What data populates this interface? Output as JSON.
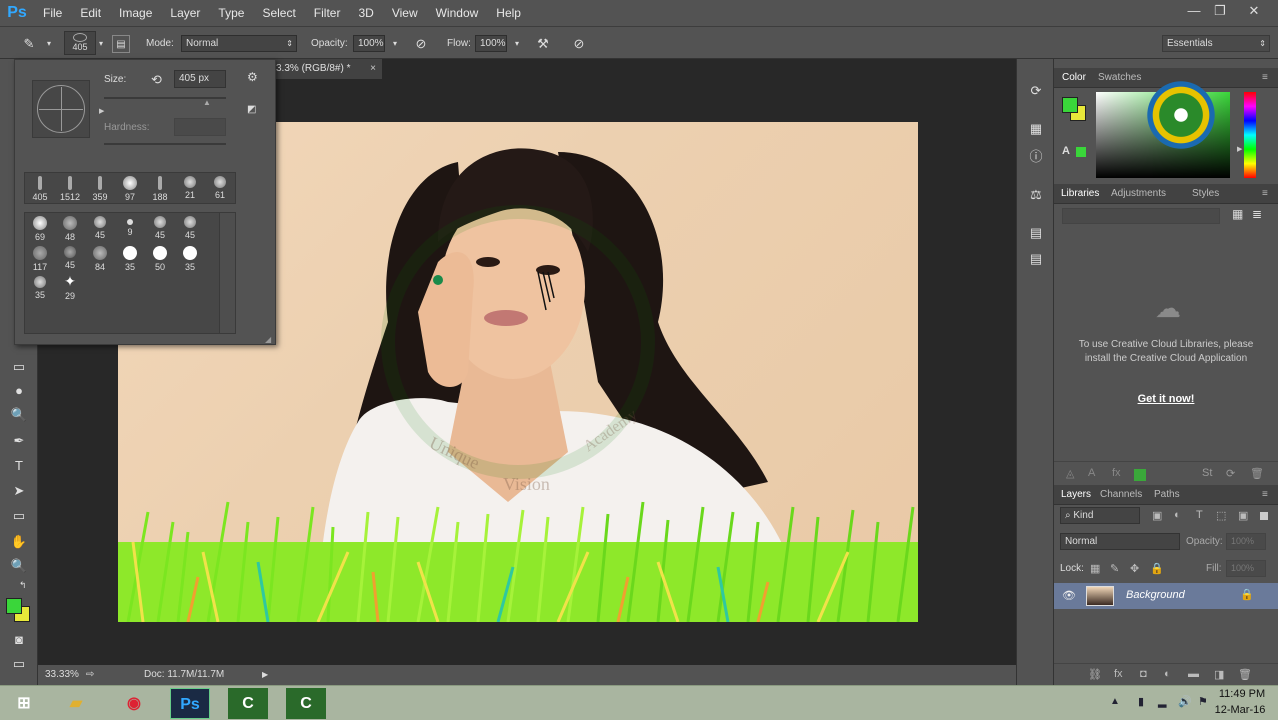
{
  "menubar": {
    "logo": "Ps",
    "items": [
      "File",
      "Edit",
      "Image",
      "Layer",
      "Type",
      "Select",
      "Filter",
      "3D",
      "View",
      "Window",
      "Help"
    ]
  },
  "options": {
    "brush_size_chip": "405",
    "mode_label": "Mode:",
    "mode_value": "Normal",
    "opacity_label": "Opacity:",
    "opacity_value": "100%",
    "flow_label": "Flow:",
    "flow_value": "100%",
    "workspace": "Essentials"
  },
  "document": {
    "tab_title": "3.3% (RGB/8#) *",
    "close_glyph": "×"
  },
  "brush_panel": {
    "size_label": "Size:",
    "size_value": "405 px",
    "hardness_label": "Hardness:",
    "row1": [
      "405",
      "1512",
      "359",
      "97",
      "188",
      "21",
      "61"
    ],
    "grid": [
      [
        "69",
        "48",
        "45",
        "9",
        "45",
        "45"
      ],
      [
        "117",
        "45",
        "84",
        "35",
        "50",
        "35"
      ],
      [
        "35",
        "29"
      ]
    ]
  },
  "status": {
    "zoom": "33.33%",
    "doc": "Doc: 11.7M/11.7M"
  },
  "color_panel": {
    "tab_color": "Color",
    "tab_swatches": "Swatches",
    "foreground": "#3ad63a",
    "background": "#e8e83a"
  },
  "libraries_panel": {
    "tab_libraries": "Libraries",
    "tab_adjustments": "Adjustments",
    "tab_styles": "Styles",
    "message": "To use Creative Cloud Libraries, please install the Creative Cloud Application",
    "link": "Get it now!"
  },
  "layers_panel": {
    "tab_layers": "Layers",
    "tab_channels": "Channels",
    "tab_paths": "Paths",
    "kind_label": "Kind",
    "blend_mode": "Normal",
    "opacity_label": "Opacity:",
    "opacity_value": "100%",
    "lock_label": "Lock:",
    "fill_label": "Fill:",
    "fill_value": "100%",
    "layer_name": "Background"
  },
  "watermark": {
    "text1": "Unique",
    "text2": "Vision",
    "text3": "Academy"
  },
  "taskbar": {
    "time": "11:49 PM",
    "date": "12-Mar-16"
  }
}
